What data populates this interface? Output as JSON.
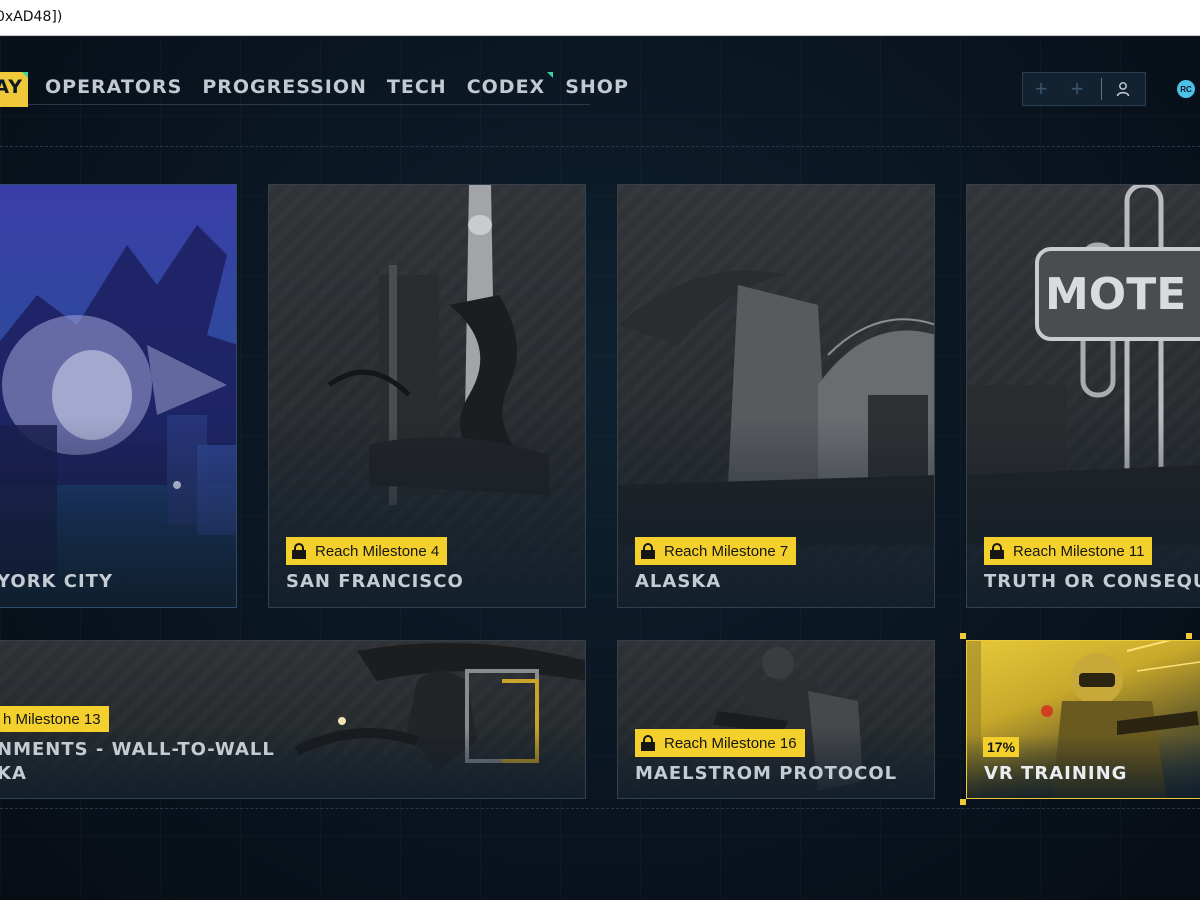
{
  "window": {
    "title": "0xAD48])"
  },
  "nav": {
    "items": [
      {
        "label": "AY",
        "active": true,
        "dot": true
      },
      {
        "label": "OPERATORS",
        "active": false,
        "dot": false
      },
      {
        "label": "PROGRESSION",
        "active": false,
        "dot": false
      },
      {
        "label": "TECH",
        "active": false,
        "dot": false
      },
      {
        "label": "CODEX",
        "active": false,
        "dot": true
      },
      {
        "label": "SHOP",
        "active": false,
        "dot": false
      }
    ]
  },
  "header_controls": {
    "plus_1": "+",
    "plus_2": "+",
    "user_icon": "user-icon",
    "currency_badge": "RC"
  },
  "cards": {
    "new_york": {
      "title": "YORK CITY"
    },
    "san_francisco": {
      "title": "SAN FRANCISCO",
      "lock": "Reach Milestone 4"
    },
    "alaska": {
      "title": "ALASKA",
      "lock": "Reach Milestone 7"
    },
    "truth": {
      "title": "TRUTH OR CONSEQUE",
      "lock": "Reach Milestone 11"
    },
    "assignments": {
      "title_line1": "NMENTS - WALL-TO-WALL",
      "title_line2": "KA",
      "lock": "h Milestone 13"
    },
    "maelstrom": {
      "title": "MAELSTROM PROTOCOL",
      "lock": "Reach Milestone 16"
    },
    "vr_training": {
      "title": "VR TRAINING",
      "progress_label": "17%",
      "progress": 0.17
    }
  },
  "colors": {
    "accent": "#f3d02b",
    "background": "#0a121c",
    "notify_dot": "#3ad3a0"
  }
}
